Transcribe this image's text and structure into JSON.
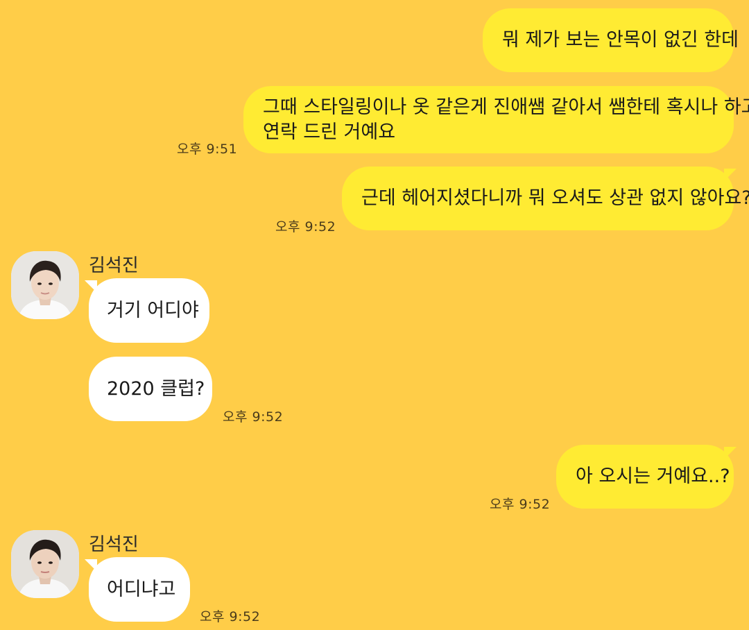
{
  "messages": [
    {
      "id": "m1",
      "side": "me",
      "text": "뭐 제가 보는 안목이 없긴 한데"
    },
    {
      "id": "m2",
      "side": "me",
      "lines": [
        "그때 스타일링이나 옷 같은게 진애쌤 같아서 쌤한테 혹시나 하고",
        "연락 드린 거예요"
      ],
      "time": "오후 9:51"
    },
    {
      "id": "m3",
      "side": "me",
      "text": "근데 헤어지셨다니까 뭐 오셔도 상관 없지 않아요?",
      "time": "오후 9:52"
    },
    {
      "id": "m4",
      "side": "them",
      "sender": "김석진",
      "text": "거기 어디야"
    },
    {
      "id": "m5",
      "side": "them",
      "text": "2020 클럽?",
      "time": "오후 9:52"
    },
    {
      "id": "m6",
      "side": "me",
      "text": "아 오시는 거예요..?",
      "time": "오후 9:52"
    },
    {
      "id": "m7",
      "side": "them",
      "sender": "김석진",
      "text": "어디냐고",
      "time": "오후 9:52"
    }
  ],
  "colors": {
    "background": "#ffcd48",
    "my_bubble": "#ffeb33",
    "their_bubble": "#ffffff"
  }
}
